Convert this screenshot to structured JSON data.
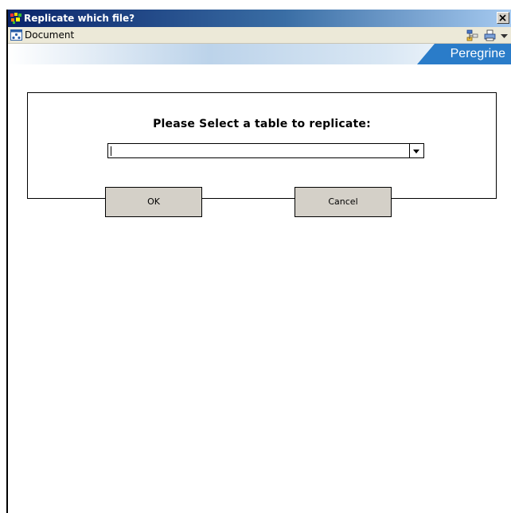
{
  "window": {
    "title": "Replicate which file?",
    "close_glyph": "×"
  },
  "toolbar": {
    "document_label": "Document",
    "icons": [
      "document-icon",
      "hierarchy-icon",
      "print-icon",
      "dropdown-arrow-icon"
    ]
  },
  "banner": {
    "brand": "Peregrine"
  },
  "dialog": {
    "prompt": "Please Select a table to replicate:",
    "table_select": {
      "value": "",
      "options": []
    },
    "ok_label": "OK",
    "cancel_label": "Cancel"
  },
  "colors": {
    "titlebar_start": "#0a246a",
    "titlebar_end": "#a6caf0",
    "brand_blue": "#2a7cc9",
    "button_face": "#d4d0c8"
  }
}
